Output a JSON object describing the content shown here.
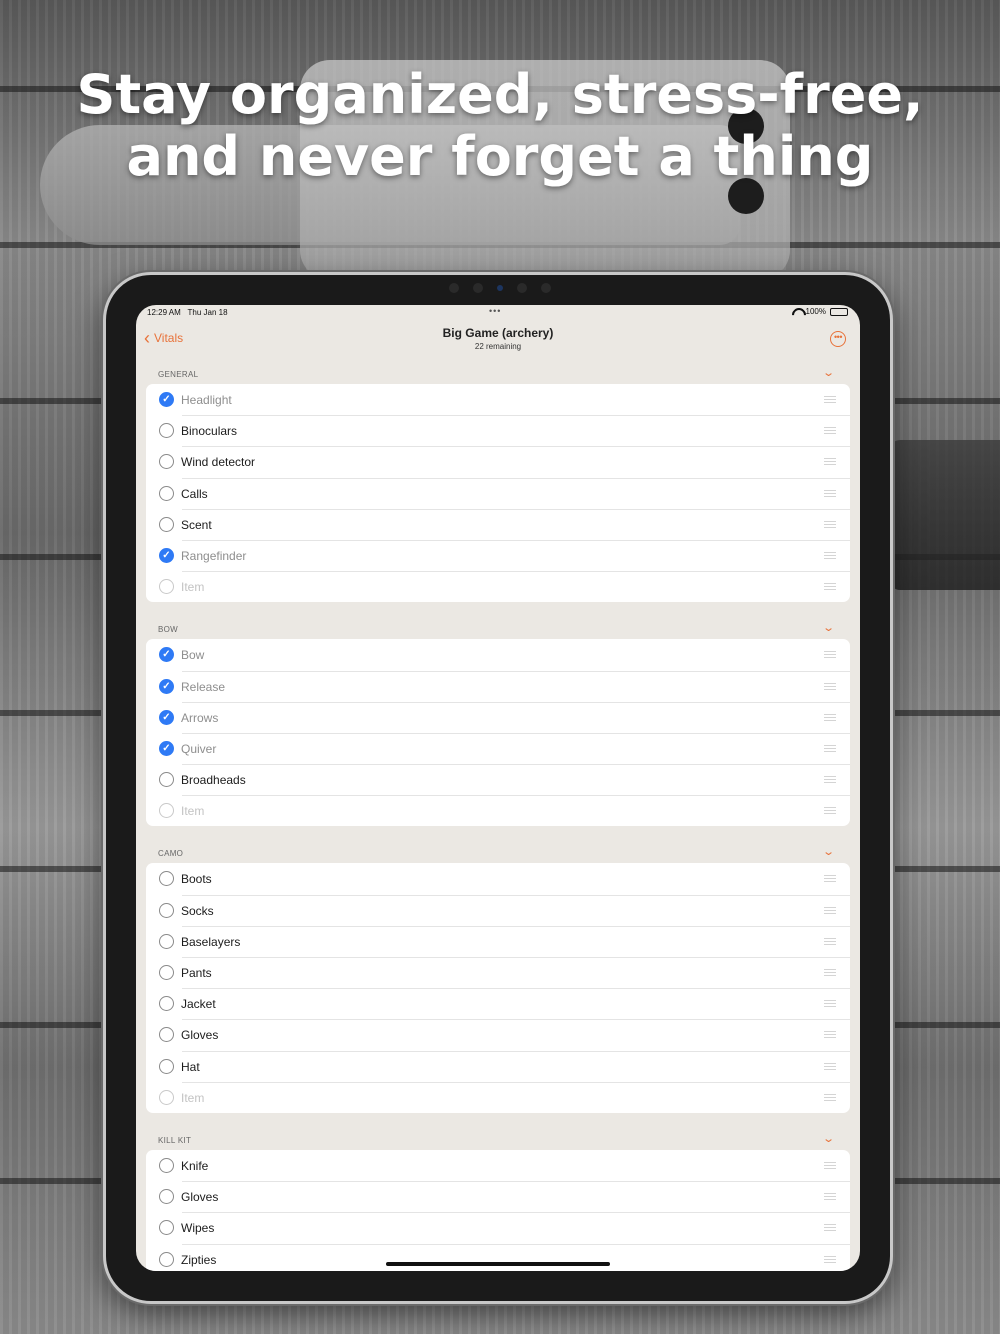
{
  "headline": {
    "line1": "Stay organized, stress-free,",
    "line2": "and never forget a thing"
  },
  "status_bar": {
    "time": "12:29 AM",
    "date": "Thu Jan 18",
    "dots": "•••",
    "battery": "100%"
  },
  "nav": {
    "back_label": "Vitals",
    "title": "Big Game (archery)",
    "subtitle": "22 remaining",
    "more_icon": "ellipsis-circle-icon"
  },
  "accent_color": "#e8723a",
  "check_color": "#2f7af5",
  "sections": [
    {
      "title": "GENERAL",
      "items": [
        {
          "label": "Headlight",
          "checked": true
        },
        {
          "label": "Binoculars",
          "checked": false
        },
        {
          "label": "Wind detector",
          "checked": false
        },
        {
          "label": "Calls",
          "checked": false
        },
        {
          "label": "Scent",
          "checked": false
        },
        {
          "label": "Rangefinder",
          "checked": true
        },
        {
          "label": "Item",
          "placeholder": true
        }
      ]
    },
    {
      "title": "BOW",
      "items": [
        {
          "label": "Bow",
          "checked": true
        },
        {
          "label": "Release",
          "checked": true
        },
        {
          "label": "Arrows",
          "checked": true
        },
        {
          "label": "Quiver",
          "checked": true
        },
        {
          "label": "Broadheads",
          "checked": false
        },
        {
          "label": "Item",
          "placeholder": true
        }
      ]
    },
    {
      "title": "CAMO",
      "items": [
        {
          "label": "Boots",
          "checked": false
        },
        {
          "label": "Socks",
          "checked": false
        },
        {
          "label": "Baselayers",
          "checked": false
        },
        {
          "label": "Pants",
          "checked": false
        },
        {
          "label": "Jacket",
          "checked": false
        },
        {
          "label": "Gloves",
          "checked": false
        },
        {
          "label": "Hat",
          "checked": false
        },
        {
          "label": "Item",
          "placeholder": true
        }
      ]
    },
    {
      "title": "KILL KIT",
      "items": [
        {
          "label": "Knife",
          "checked": false
        },
        {
          "label": "Gloves",
          "checked": false
        },
        {
          "label": "Wipes",
          "checked": false
        },
        {
          "label": "Zipties",
          "checked": false
        }
      ]
    }
  ]
}
